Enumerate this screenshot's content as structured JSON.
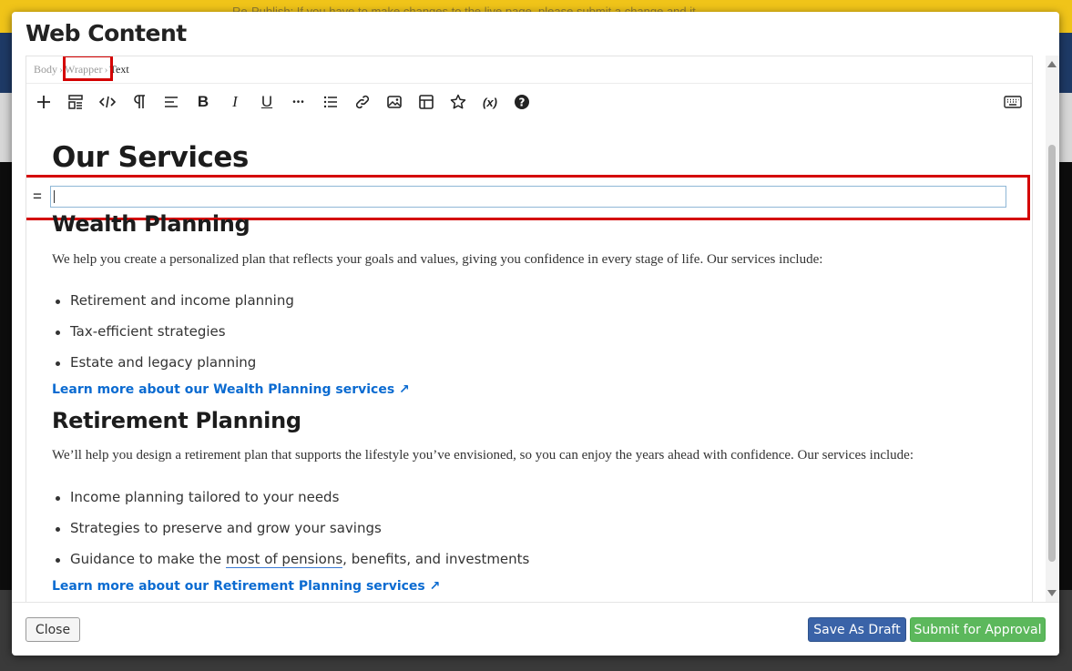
{
  "background": {
    "notice": "Re-Publish: If you have to make changes to the live page, please submit a change and it..."
  },
  "modal": {
    "title": "Web Content"
  },
  "breadcrumb": {
    "items": [
      "Body",
      "Wrapper",
      "Text"
    ]
  },
  "toolbar": {
    "buttons": [
      {
        "name": "add-icon"
      },
      {
        "name": "block-format-icon"
      },
      {
        "name": "source-code-icon"
      },
      {
        "name": "paragraph-icon"
      },
      {
        "name": "align-icon"
      },
      {
        "name": "bold-icon",
        "glyph": "B"
      },
      {
        "name": "italic-icon",
        "glyph": "I"
      },
      {
        "name": "underline-icon",
        "glyph": "U"
      },
      {
        "name": "more-icon",
        "glyph": "•••"
      },
      {
        "name": "list-icon"
      },
      {
        "name": "link-icon"
      },
      {
        "name": "image-icon"
      },
      {
        "name": "table-icon"
      },
      {
        "name": "star-icon"
      },
      {
        "name": "variable-icon",
        "glyph": "(x)"
      },
      {
        "name": "help-icon",
        "glyph": "?"
      },
      {
        "name": "keyboard-icon"
      }
    ]
  },
  "content": {
    "heading": "Our Services",
    "drag_handle": "=",
    "sections": [
      {
        "title": "Wealth Planning",
        "intro": "We help you create a personalized plan that reflects your goals and values, giving you confidence in every stage of life. Our services include:",
        "items": [
          "Retirement and income planning",
          "Tax-efficient strategies",
          "Estate and legacy planning"
        ],
        "link": "Learn more about our Wealth Planning services ↗"
      },
      {
        "title": "Retirement Planning",
        "intro": "We’ll help you design a retirement plan that supports the lifestyle you’ve envisioned, so you can enjoy the years ahead with confidence. Our services include:",
        "items": [
          "Income planning tailored to your needs",
          "Strategies to preserve and grow your savings"
        ],
        "item3_prefix": "Guidance to make the ",
        "item3_underlined": "most of pensions",
        "item3_suffix": ", benefits, and investments",
        "link": "Learn more about our Retirement Planning services ↗"
      }
    ]
  },
  "footer": {
    "close_label": "Close",
    "draft_label": "Save As Draft",
    "submit_label": "Submit for Approval"
  },
  "colors": {
    "highlight": "#d40000",
    "link": "#0b6bd1",
    "draft_button": "#3a63a8",
    "submit_button": "#5cb85c"
  }
}
